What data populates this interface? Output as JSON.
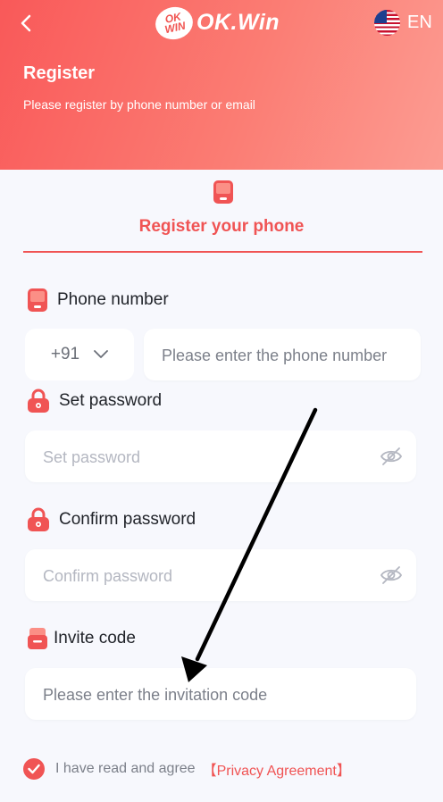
{
  "header": {
    "logo_badge": "OK WIN",
    "logo_text": "OK.Win",
    "language": "EN",
    "title": "Register",
    "subtitle": "Please register by phone number or email"
  },
  "tab": {
    "label": "Register your phone"
  },
  "phone": {
    "label": "Phone number",
    "country_code": "+91",
    "placeholder": "Please enter the phone number"
  },
  "password": {
    "label": "Set password",
    "placeholder": "Set password"
  },
  "confirm": {
    "label": "Confirm password",
    "placeholder": "Confirm password"
  },
  "invite": {
    "label": "Invite code",
    "placeholder": "Please enter the invitation code"
  },
  "agreement": {
    "text": "I have read and agree",
    "link": "【Privacy Agreement】",
    "checked": true
  },
  "colors": {
    "accent": "#f05454",
    "header_start": "#f95959",
    "header_end": "#fc9c92"
  },
  "icons": [
    "back-icon",
    "us-flag-icon",
    "phone-icon",
    "lock-icon",
    "eye-off-icon",
    "invite-icon",
    "checkmark-icon"
  ]
}
